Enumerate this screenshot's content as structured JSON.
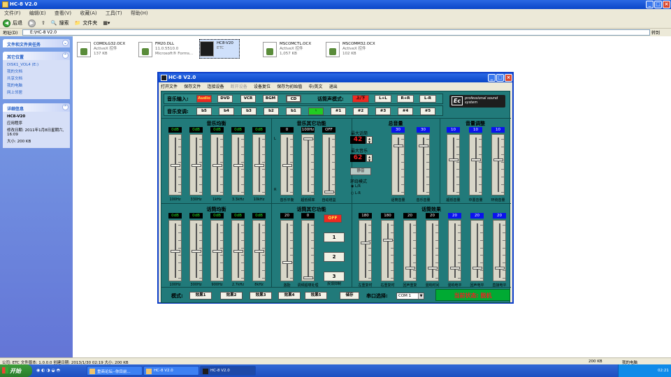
{
  "explorer": {
    "title": "HC-8 V2.0",
    "menu": [
      "文件(F)",
      "编辑(E)",
      "查看(V)",
      "收藏(A)",
      "工具(T)",
      "帮助(H)"
    ],
    "toolbar": {
      "back": "后退",
      "search": "搜索",
      "folders": "文件夹"
    },
    "address_label": "地址(D)",
    "address_value": "E:\\HC-8 V2.0",
    "go_label": "转到"
  },
  "sidebar": {
    "tasks_title": "文件和文件夹任务",
    "places_title": "其它位置",
    "places": [
      "DISK1_VOL4 (E:)",
      "我的文档",
      "共享文档",
      "我的电脑",
      "网上邻居"
    ],
    "details_title": "详细信息",
    "details_name": "HC8-V20",
    "details_type": "应用程序",
    "details_modified": "修改日期: 2011年1月8日星期六, 16:09",
    "details_size": "大小: 200 KB"
  },
  "files": [
    {
      "name": "COMDLG32.OCX",
      "type": "ActiveX 控件",
      "size": "137 KB"
    },
    {
      "name": "FM20.DLL",
      "type": "11.0.5510.0",
      "size": "Microsoft® Forms..."
    },
    {
      "name": "HC8-V20",
      "type": "ETC",
      "size": ""
    },
    {
      "name": "MSCOMCTL.OCX",
      "type": "ActiveX 控件",
      "size": "1,057 KB"
    },
    {
      "name": "MSCOMM32.OCX",
      "type": "ActiveX 控件",
      "size": "102 KB"
    }
  ],
  "app": {
    "title": "HC-8 V2.0",
    "menu": [
      "打开文件",
      "保存文件",
      "连接设备",
      "断开设备",
      "设备复位",
      "保存为初始值",
      "中/英文",
      "退出"
    ],
    "music_input_label": "音乐输入:",
    "music_inputs": [
      "Audio",
      "DVD",
      "VCR",
      "BGM",
      "CD"
    ],
    "vocal_mode_label": "话筒声模式:",
    "vocal_modes": [
      "上/下",
      "L+L",
      "R+R",
      "L-R"
    ],
    "key_label": "音乐变调:",
    "keys": [
      "b5",
      "b4",
      "b3",
      "b2",
      "b1",
      "♮",
      "#1",
      "#2",
      "#3",
      "#4",
      "#5"
    ],
    "logo_text": "professional sound system",
    "music_eq": {
      "title": "音乐均衡",
      "values": [
        "0dB",
        "0dB",
        "0dB",
        "0dB",
        "0dB"
      ],
      "freqs": [
        "100Hz",
        "330Hz",
        "1kHz",
        "3.3kHz",
        "10kHz"
      ]
    },
    "music_other": {
      "title": "音乐其它功能",
      "values": [
        "0",
        "100Hz",
        "OFF"
      ],
      "captions": [
        "音乐平衡",
        "超低频率",
        "自动增益"
      ],
      "lr_left": "L",
      "lr_right": "R"
    },
    "max_vocal_label": "最大话筒",
    "max_vocal_value": "42",
    "max_music_label": "最大音乐",
    "max_music_value": "62",
    "mute_label": "静音",
    "surround_label": "环绕模式",
    "surround_opts": [
      "L/R",
      "L-R"
    ],
    "total_volume": {
      "title": "总音量",
      "values": [
        "30",
        "30"
      ],
      "captions": [
        "话筒音量",
        "音乐音量"
      ]
    },
    "volume_adjust": {
      "title": "音量调整",
      "values": [
        "10",
        "10",
        "10"
      ],
      "captions": [
        "超低音量",
        "中置音量",
        "环绕音量"
      ]
    },
    "vocal_eq": {
      "title": "话筒均衡",
      "values": [
        "0dB",
        "0dB",
        "0dB",
        "0dB",
        "0dB"
      ],
      "freqs": [
        "100Hz",
        "300Hz",
        "900Hz",
        "2.7kHz",
        "8kHz"
      ]
    },
    "vocal_other": {
      "title": "话筒其它功能",
      "values": [
        "20",
        "0"
      ],
      "captions": [
        "激励",
        "调频超啸处理"
      ],
      "off_label": "OFF",
      "buttons": [
        "1",
        "2",
        "3"
      ],
      "feedback_caption": "反馈抑制"
    },
    "vocal_effect": {
      "title": "话筒效果",
      "values_black": [
        "180",
        "180",
        "20",
        "20"
      ],
      "values_blue": [
        "20",
        "20",
        "20"
      ],
      "captions": [
        "左重复时",
        "右重复时",
        "回声重复",
        "混响时间",
        "混响电平",
        "回声电平",
        "直接电平"
      ]
    },
    "mode_label": "模式:",
    "effects": [
      "效果1",
      "效果2",
      "效果3",
      "效果4",
      "效果5"
    ],
    "store_label": "储存",
    "port_label": "串口选择:",
    "port_value": "COM 1",
    "status_text": "当前状态: 脱机"
  },
  "statusbar": {
    "left": "公司: ETC 文件版本: 1.0.0.0 创建日期: 2013/1/30 02:19 大小: 200 KB",
    "size": "200 KB",
    "location": "我的电脑"
  },
  "taskbar": {
    "start": "开始",
    "tasks": [
      "重商论坛--你目前...",
      "HC-8 V2.0",
      "HC-8 V2.0"
    ],
    "clock": "02:21"
  }
}
